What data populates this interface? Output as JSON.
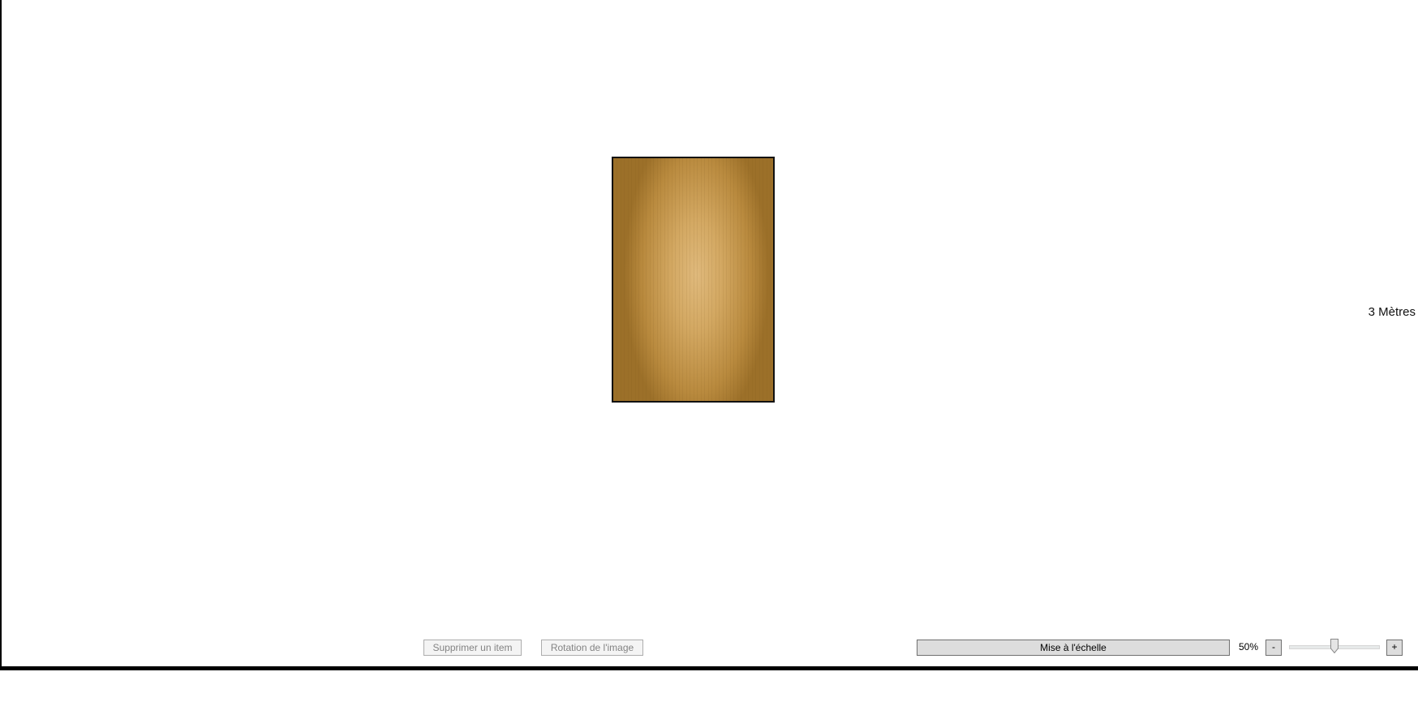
{
  "canvas": {
    "scale_label": "3 Mètres"
  },
  "toolbar": {
    "delete_item_label": "Supprimer un item",
    "rotate_image_label": "Rotation de l'image",
    "scale_button_label": "Mise à l'échelle",
    "zoom_value_label": "50%",
    "zoom_out_label": "-",
    "zoom_in_label": "+",
    "zoom_slider_fraction": 0.5
  },
  "colors": {
    "frame": "#000000",
    "wood": "#d3a862",
    "button_face": "#dddddd",
    "disabled_text": "#838383"
  }
}
